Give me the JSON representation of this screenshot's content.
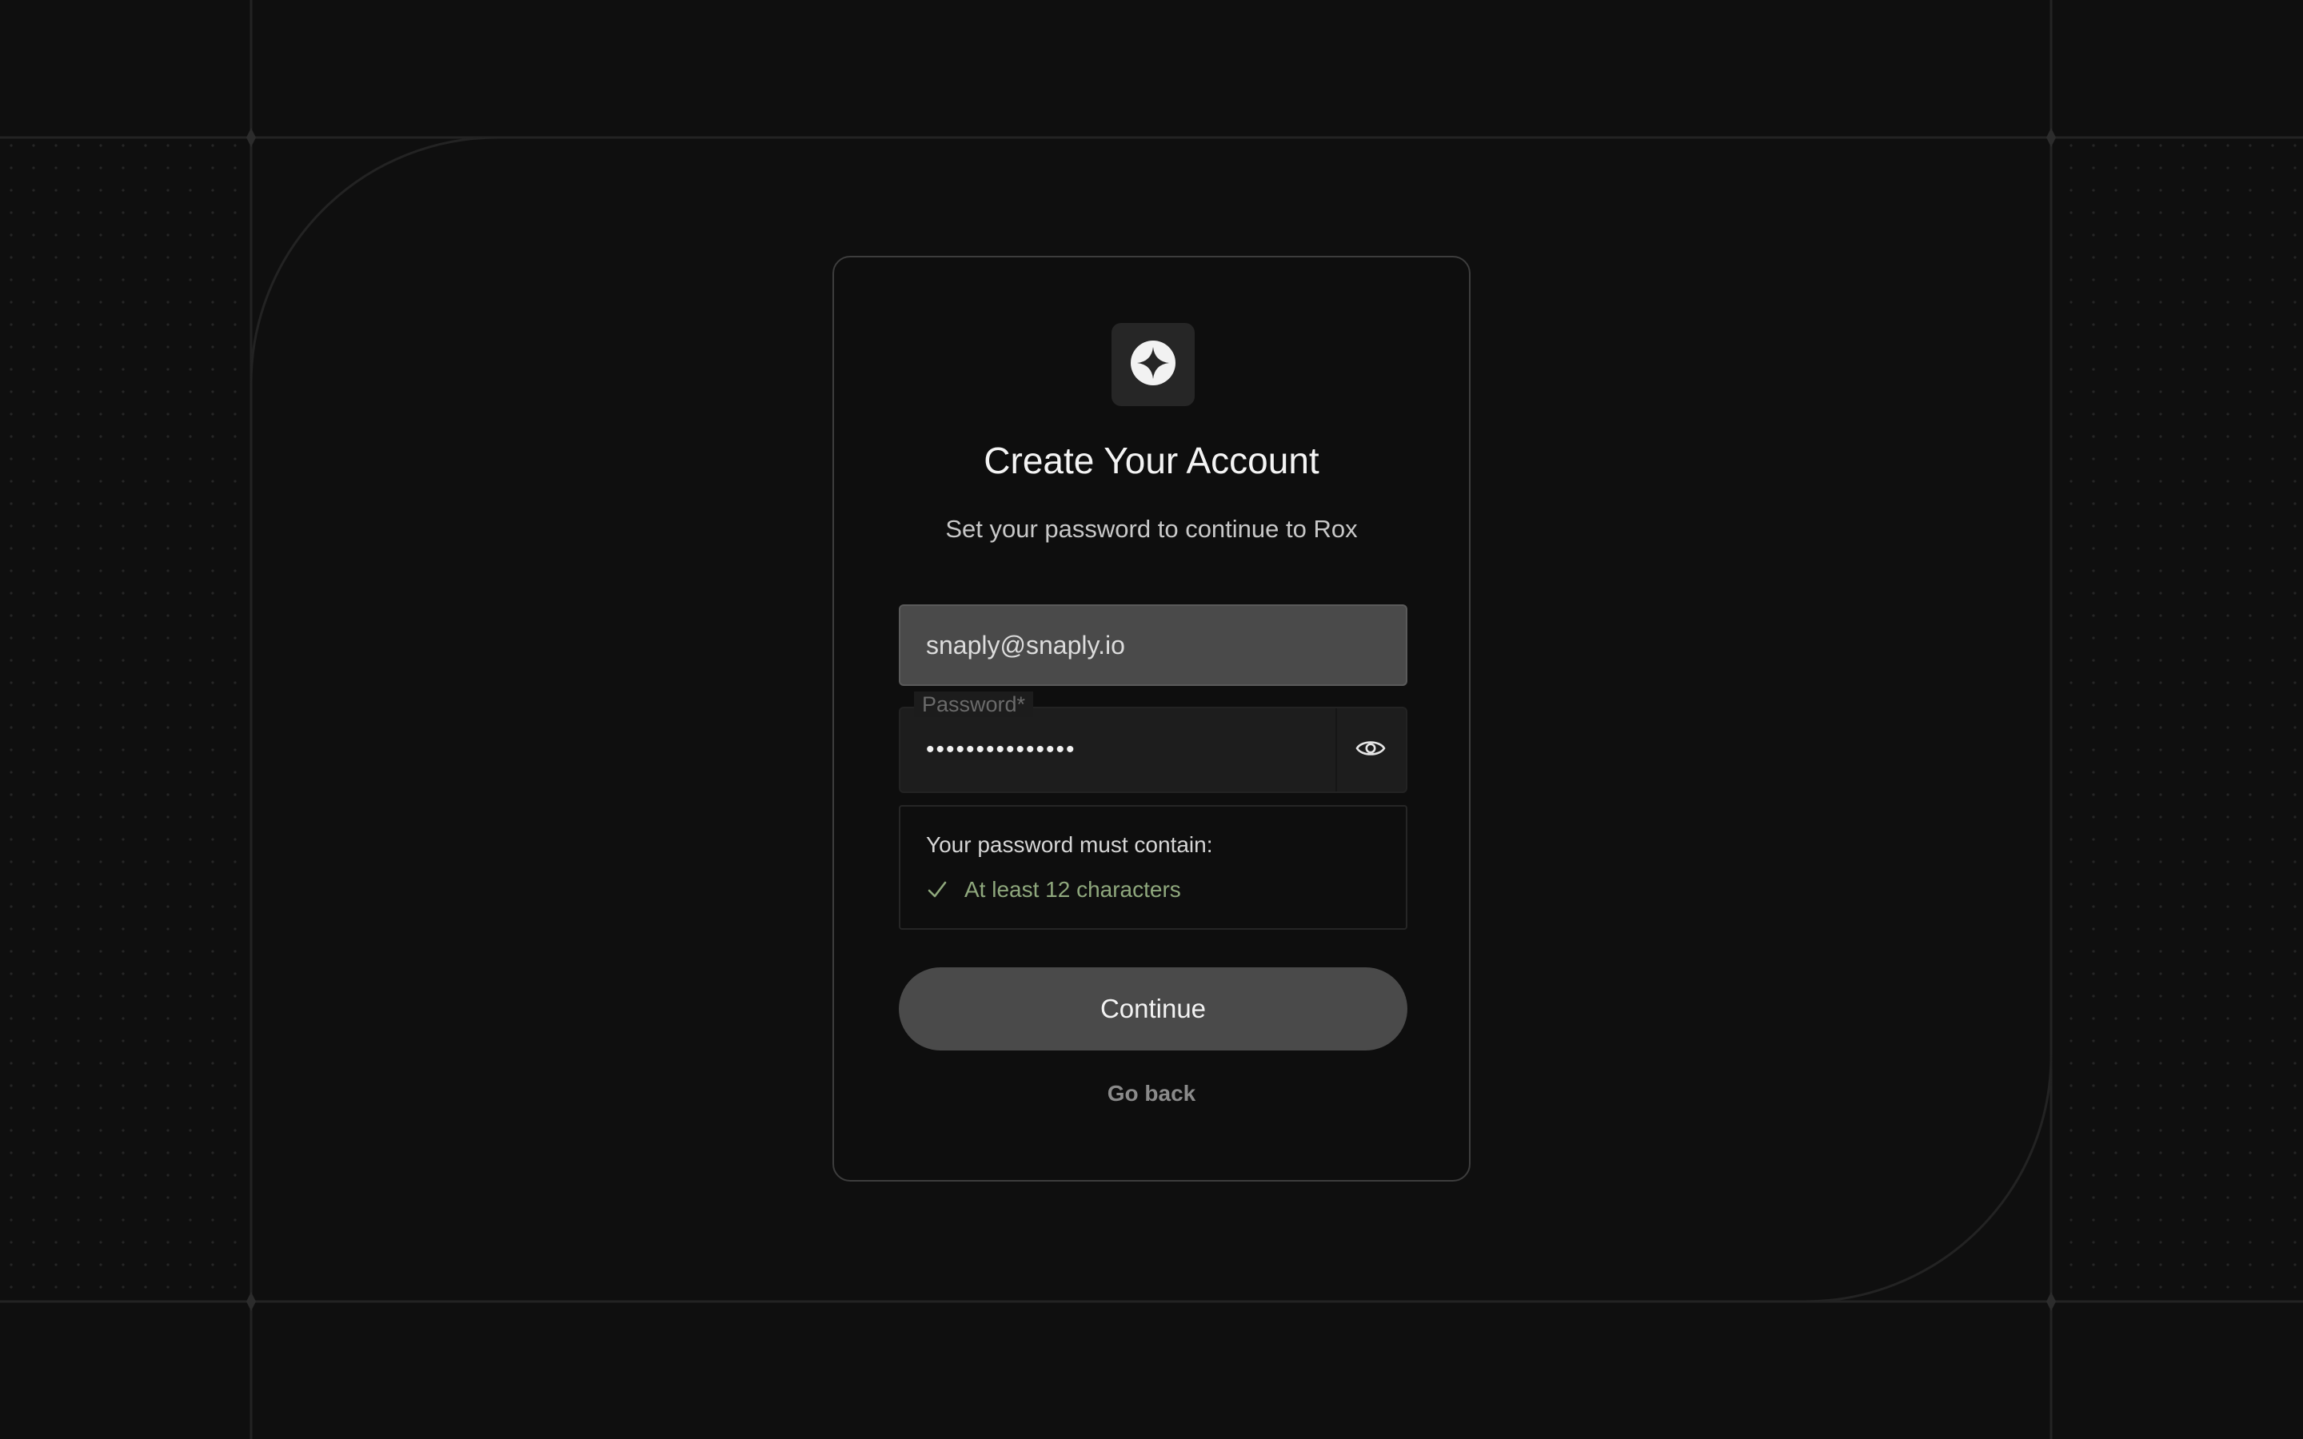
{
  "brand": {
    "logo_icon": "four-point-star-icon"
  },
  "header": {
    "title": "Create Your Account",
    "subtitle": "Set your password to continue to Rox"
  },
  "form": {
    "email_value": "snaply@snaply.io",
    "password_label": "Password*",
    "password_masked": "•••••••••••••••",
    "show_password_icon": "eye-icon"
  },
  "requirements": {
    "title": "Your password must contain:",
    "items": [
      {
        "label": "At least 12 characters",
        "met": true,
        "icon": "checkmark-icon"
      }
    ]
  },
  "actions": {
    "continue_label": "Continue",
    "go_back_label": "Go back"
  },
  "colors": {
    "background": "#0f0f0f",
    "card_border": "#3d3d3d",
    "button": "#4a4a4a",
    "success": "#8fa87d"
  }
}
